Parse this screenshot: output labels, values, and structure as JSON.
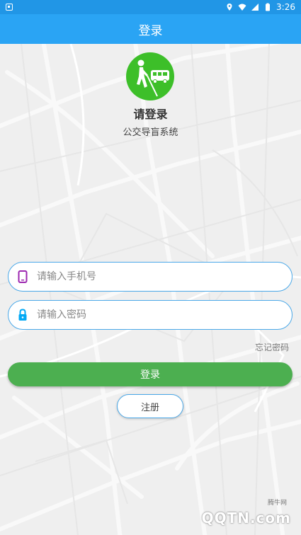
{
  "status_bar": {
    "time": "3:26",
    "icons": [
      "notification-icon",
      "location-icon",
      "wifi-icon",
      "signal-icon",
      "battery-icon"
    ]
  },
  "app_bar": {
    "title": "登录"
  },
  "logo": {
    "icon": "blind-person-bus-icon",
    "color": "#3dbf29"
  },
  "header": {
    "title": "请登录",
    "subtitle": "公交导盲系统"
  },
  "form": {
    "phone": {
      "placeholder": "请输入手机号",
      "value": "",
      "icon": "phone-icon",
      "icon_color": "#9c27b0"
    },
    "password": {
      "placeholder": "请输入密码",
      "value": "",
      "icon": "lock-icon",
      "icon_color": "#03a9f4"
    },
    "forgot_label": "忘记密码",
    "login_label": "登录",
    "register_label": "注册"
  },
  "watermark": {
    "text": "QQTN.com",
    "small": "腾牛网"
  },
  "colors": {
    "status_bar": "#2196e6",
    "app_bar": "#2aa4f4",
    "login_button": "#4caf50",
    "field_border": "#4aa8e8"
  }
}
